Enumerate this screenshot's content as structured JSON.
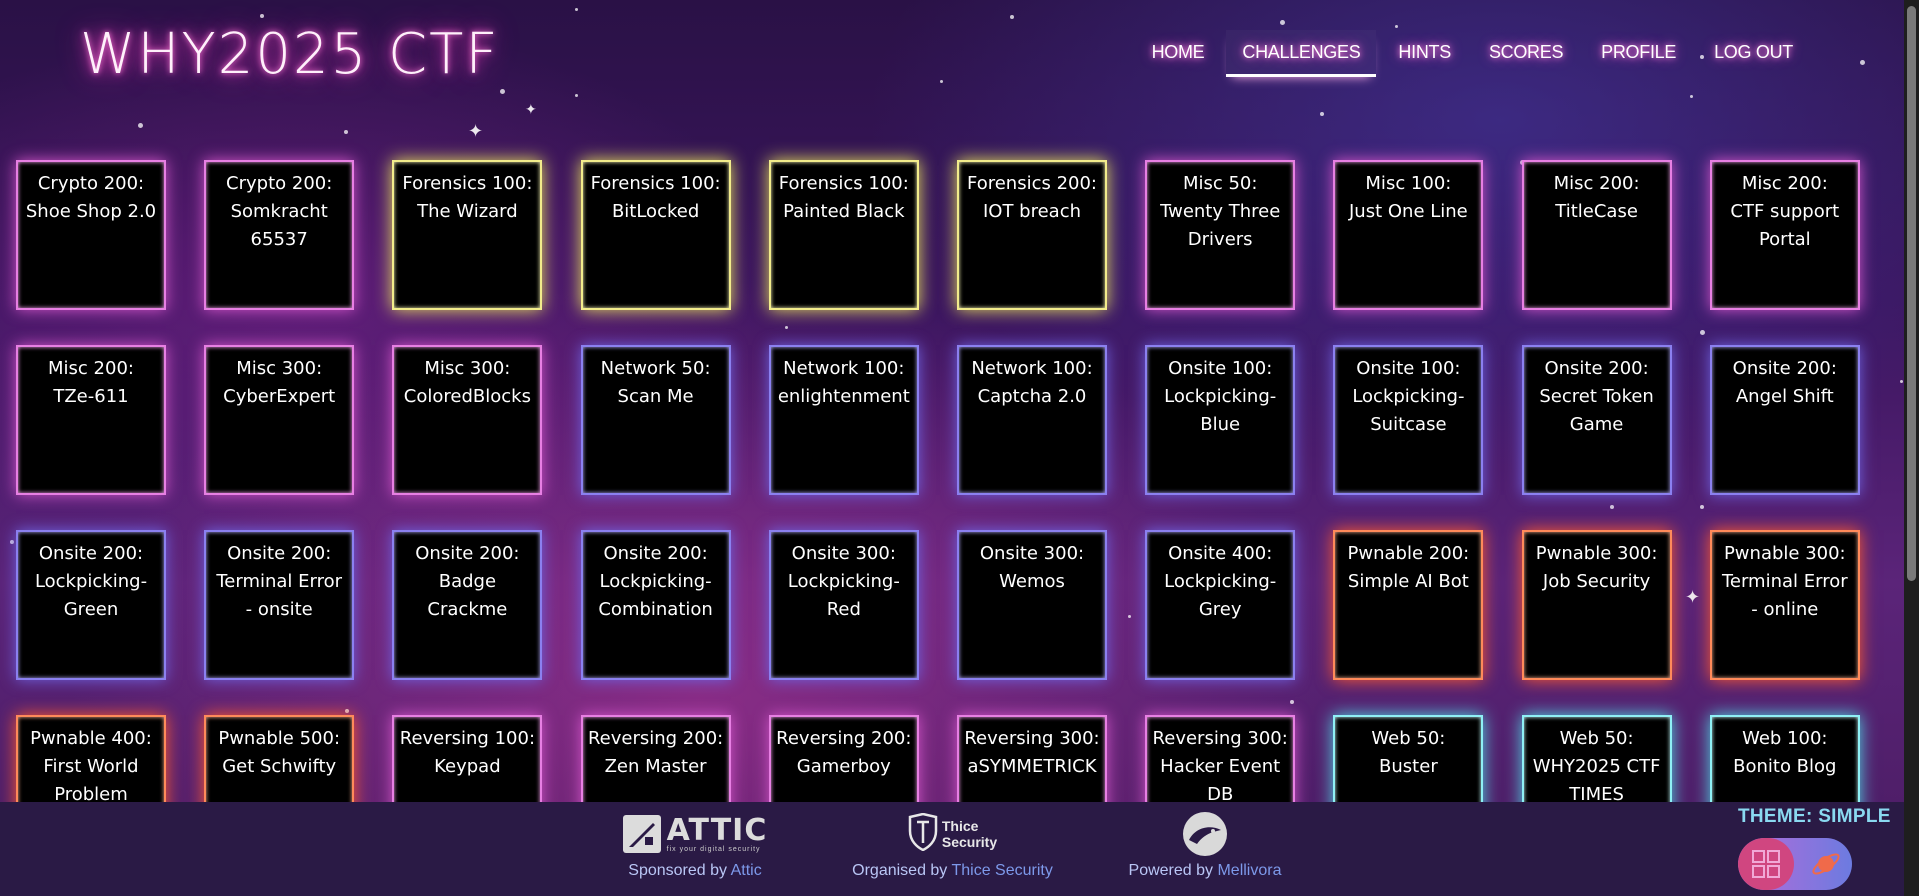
{
  "site": {
    "title": "WHY2025 CTF"
  },
  "nav": {
    "items": [
      {
        "label": "HOME",
        "active": false
      },
      {
        "label": "CHALLENGES",
        "active": true
      },
      {
        "label": "HINTS",
        "active": false
      },
      {
        "label": "SCORES",
        "active": false
      },
      {
        "label": "PROFILE",
        "active": false
      },
      {
        "label": "LOG OUT",
        "active": false
      }
    ]
  },
  "challenges": [
    {
      "lines": [
        "Crypto 200:",
        "Shoe Shop 2.0"
      ],
      "color": "pink"
    },
    {
      "lines": [
        "Crypto 200:",
        "Somkracht",
        "65537"
      ],
      "color": "pink"
    },
    {
      "lines": [
        "Forensics 100:",
        "The Wizard"
      ],
      "color": "yellow"
    },
    {
      "lines": [
        "Forensics 100:",
        "BitLocked"
      ],
      "color": "yellow"
    },
    {
      "lines": [
        "Forensics 100:",
        "Painted Black"
      ],
      "color": "yellow"
    },
    {
      "lines": [
        "Forensics 200:",
        "IOT breach"
      ],
      "color": "yellow"
    },
    {
      "lines": [
        "Misc 50:",
        "Twenty Three",
        "Drivers"
      ],
      "color": "pink"
    },
    {
      "lines": [
        "Misc 100:",
        "Just One Line"
      ],
      "color": "pink"
    },
    {
      "lines": [
        "Misc 200:",
        "TitleCase"
      ],
      "color": "pink"
    },
    {
      "lines": [
        "Misc 200:",
        "CTF support",
        "Portal"
      ],
      "color": "pink"
    },
    {
      "lines": [
        "Misc 200:",
        "TZe-611"
      ],
      "color": "pink"
    },
    {
      "lines": [
        "Misc 300:",
        "CyberExpert"
      ],
      "color": "pink"
    },
    {
      "lines": [
        "Misc 300:",
        "ColoredBlocks"
      ],
      "color": "pink"
    },
    {
      "lines": [
        "Network 50:",
        "Scan Me"
      ],
      "color": "blue"
    },
    {
      "lines": [
        "Network 100:",
        "enlightenment"
      ],
      "color": "blue"
    },
    {
      "lines": [
        "Network 100:",
        "Captcha 2.0"
      ],
      "color": "blue"
    },
    {
      "lines": [
        "Onsite 100:",
        "Lockpicking-",
        "Blue"
      ],
      "color": "blue"
    },
    {
      "lines": [
        "Onsite 100:",
        "Lockpicking-",
        "Suitcase"
      ],
      "color": "blue"
    },
    {
      "lines": [
        "Onsite 200:",
        "Secret Token",
        "Game"
      ],
      "color": "blue"
    },
    {
      "lines": [
        "Onsite 200:",
        "Angel Shift"
      ],
      "color": "blue"
    },
    {
      "lines": [
        "Onsite 200:",
        "Lockpicking-",
        "Green"
      ],
      "color": "blue"
    },
    {
      "lines": [
        "Onsite 200:",
        "Terminal Error",
        "- onsite"
      ],
      "color": "blue"
    },
    {
      "lines": [
        "Onsite 200:",
        "Badge",
        "Crackme"
      ],
      "color": "blue"
    },
    {
      "lines": [
        "Onsite 200:",
        "Lockpicking-",
        "Combination"
      ],
      "color": "blue"
    },
    {
      "lines": [
        "Onsite 300:",
        "Lockpicking-",
        "Red"
      ],
      "color": "blue"
    },
    {
      "lines": [
        "Onsite 300:",
        "Wemos"
      ],
      "color": "blue"
    },
    {
      "lines": [
        "Onsite 400:",
        "Lockpicking-",
        "Grey"
      ],
      "color": "blue"
    },
    {
      "lines": [
        "Pwnable 200:",
        "Simple AI Bot"
      ],
      "color": "orange"
    },
    {
      "lines": [
        "Pwnable 300:",
        "Job Security"
      ],
      "color": "orange"
    },
    {
      "lines": [
        "Pwnable 300:",
        "Terminal Error",
        "- online"
      ],
      "color": "orange"
    },
    {
      "lines": [
        "Pwnable 400:",
        "First World",
        "Problem"
      ],
      "color": "orange"
    },
    {
      "lines": [
        "Pwnable 500:",
        "Get Schwifty"
      ],
      "color": "orange"
    },
    {
      "lines": [
        "Reversing 100:",
        "Keypad"
      ],
      "color": "pink"
    },
    {
      "lines": [
        "Reversing 200:",
        "Zen Master"
      ],
      "color": "pink"
    },
    {
      "lines": [
        "Reversing 200:",
        "Gamerboy"
      ],
      "color": "pink"
    },
    {
      "lines": [
        "Reversing 300:",
        "aSYMMETRICK"
      ],
      "color": "pink"
    },
    {
      "lines": [
        "Reversing 300:",
        "Hacker Event",
        "DB"
      ],
      "color": "pink"
    },
    {
      "lines": [
        "Web 50:",
        "Buster"
      ],
      "color": "cyan"
    },
    {
      "lines": [
        "Web 50:",
        "WHY2025 CTF",
        "TIMES"
      ],
      "color": "cyan"
    },
    {
      "lines": [
        "Web 100:",
        "Bonito Blog"
      ],
      "color": "cyan"
    }
  ],
  "footer": {
    "sponsored": {
      "prefix": "Sponsored by",
      "name": "Attic",
      "logo_word": "ATTIC",
      "logo_tag": "fix your digital security"
    },
    "organised": {
      "prefix": "Organised by",
      "name": "Thice Security",
      "logo_line1": "Thice",
      "logo_line2": "Security"
    },
    "powered": {
      "prefix": "Powered by",
      "name": "Mellivora"
    }
  },
  "theme": {
    "label": "THEME: SIMPLE"
  },
  "colors": {
    "pink": "#e77fe3",
    "yellow": "#f2ec8b",
    "blue": "#8b80f0",
    "orange": "#ff8a5a",
    "cyan": "#8ff0f5",
    "footer_bg": "#2a1a45",
    "theme_label": "#8ad9f0"
  }
}
